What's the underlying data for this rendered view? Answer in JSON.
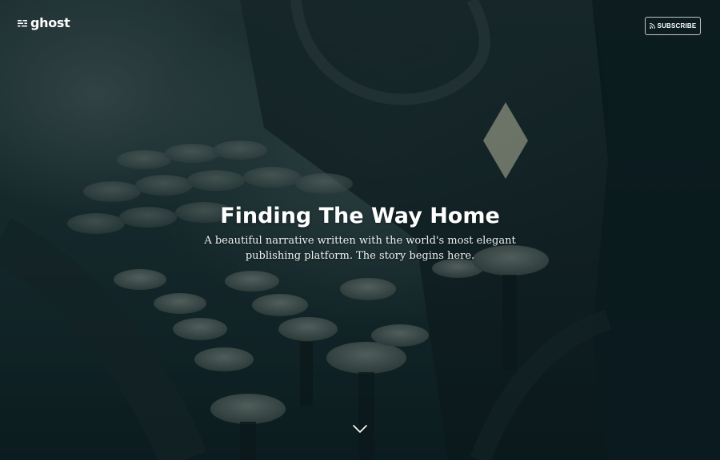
{
  "header": {
    "logo_text": "ghost",
    "logo_icon": "ghost-logo-icon",
    "subscribe_label": "SUBSCRIBE",
    "subscribe_icon": "rss-icon"
  },
  "hero": {
    "title": "Finding The Way Home",
    "description": "A beautiful narrative written with the world's most elegant publishing platform. The story begins here.",
    "scroll_icon": "chevron-down-icon",
    "background_image": "typewriter-photo"
  },
  "colors": {
    "overlay": "#0f2a2e",
    "text": "#ffffff"
  }
}
